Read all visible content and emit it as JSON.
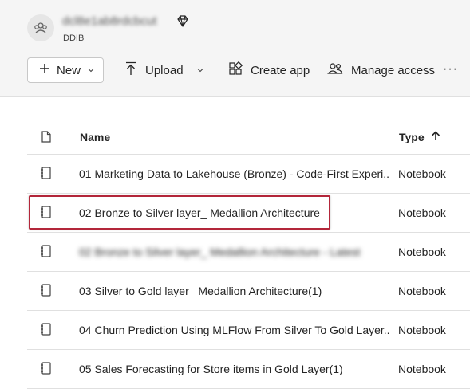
{
  "workspace": {
    "name": "dcl8e1ab8rdcbcut",
    "subtitle": "DDIB"
  },
  "toolbar": {
    "new_label": "New",
    "upload_label": "Upload",
    "create_app_label": "Create app",
    "manage_access_label": "Manage access",
    "more_label": "···"
  },
  "table": {
    "columns": {
      "name": "Name",
      "type": "Type"
    },
    "rows": [
      {
        "name": "01 Marketing Data to Lakehouse (Bronze) - Code-First Experi...",
        "type": "Notebook"
      },
      {
        "name": "02 Bronze to Silver layer_ Medallion Architecture",
        "type": "Notebook"
      },
      {
        "name": "02 Bronze to Silver layer_ Medallion Architecture - Latest",
        "type": "Notebook"
      },
      {
        "name": "03 Silver to Gold layer_ Medallion Architecture(1)",
        "type": "Notebook"
      },
      {
        "name": "04 Churn Prediction Using MLFlow From Silver To Gold Layer...",
        "type": "Notebook"
      },
      {
        "name": "05 Sales Forecasting for Store items in Gold Layer(1)",
        "type": "Notebook"
      }
    ]
  },
  "colors": {
    "highlight": "#b3263a",
    "toolbar_bg": "#f5f5f5"
  }
}
